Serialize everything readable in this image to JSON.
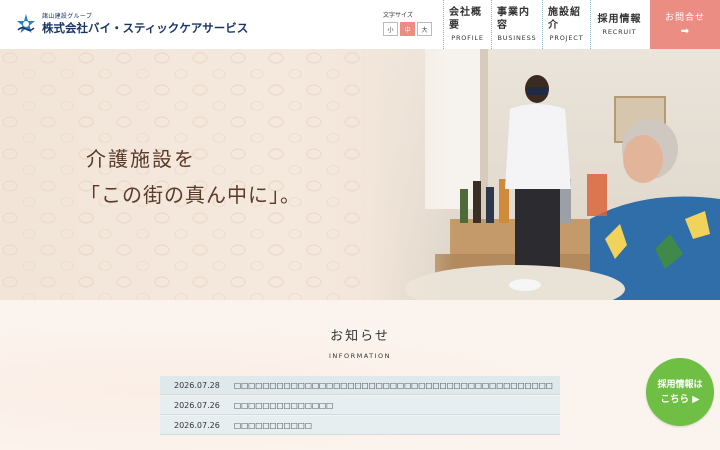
{
  "header": {
    "logo_sub": "諸山建設グループ",
    "logo_main": "株式会社バイ・スティックケアサービス",
    "font_size_label": "文字サイズ",
    "font_size_buttons": [
      "小",
      "中",
      "大"
    ],
    "font_size_active": "中",
    "nav": [
      {
        "jp": "会社概要",
        "en": "PROFILE"
      },
      {
        "jp": "事業内容",
        "en": "BUSINESS"
      },
      {
        "jp": "施設紹介",
        "en": "PROJECT"
      },
      {
        "jp": "採用情報",
        "en": "RECRUIT"
      }
    ],
    "contact_label": "お問合せ",
    "contact_arrow": "➡"
  },
  "hero": {
    "line1": "介護施設を",
    "line2": "「この街の真ん中に」。"
  },
  "news": {
    "title": "お知らせ",
    "subtitle": "INFORMATION",
    "items": [
      {
        "date": "2026.07.28",
        "text": "□□□□□□□□□□□□□□□□□□□□□□□□□□□□□□□□□□□□□□□□□□□□□"
      },
      {
        "date": "2026.07.26",
        "text": "□□□□□□□□□□□□□□"
      },
      {
        "date": "2026.07.26",
        "text": "□□□□□□□□□□□"
      }
    ]
  },
  "recruit_bubble": {
    "line1": "採用情報は",
    "line2": "こちら ▶"
  },
  "colors": {
    "brand_navy": "#1b3566",
    "accent_pink": "#ec8d84",
    "recruit_green": "#6fbf44",
    "news_row": "#e6eef0"
  }
}
